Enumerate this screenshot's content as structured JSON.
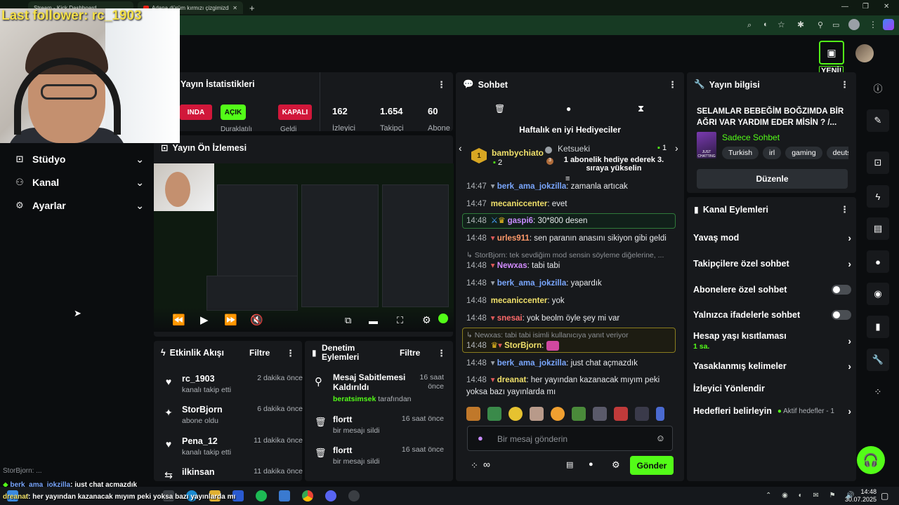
{
  "browser": {
    "tabs": [
      {
        "label": "Stream - Kick Dashboard"
      },
      {
        "label": "Adana dürüm kırmızı çizgimizdir"
      }
    ],
    "new_tab": "+",
    "win_min": "—",
    "win_max": "❐",
    "win_close": "✕"
  },
  "overlay": {
    "follower_text": "Last follower: rc_1903"
  },
  "header": {
    "new_badge": "YENİ!"
  },
  "sidebar": {
    "items": [
      {
        "label": "Stüdyo",
        "icon": "studio-icon"
      },
      {
        "label": "Kanal",
        "icon": "users-icon"
      },
      {
        "label": "Ayarlar",
        "icon": "gear-icon"
      }
    ]
  },
  "stats": {
    "title": "Yayın İstatistikleri",
    "status_left": "INDA",
    "open_label": "AÇIK",
    "closed_label": "KAPALI",
    "sub_left": "Duraklatılı",
    "sub_closed": "Geldi",
    "viewers_value": "162",
    "viewers_label": "İzleyici",
    "followers_value": "1.654",
    "followers_label": "Takipçi",
    "subs_value": "60",
    "subs_label": "Abone"
  },
  "preview": {
    "title": "Yayın Ön İzlemesi"
  },
  "activity": {
    "title": "Etkinlik Akışı",
    "filter": "Filtre",
    "items": [
      {
        "name": "rc_1903",
        "sub": "kanalı takip etti",
        "time": "2 dakika önce",
        "icon": "heart-icon"
      },
      {
        "name": "StorBjorn",
        "sub": "abone oldu",
        "time": "6 dakika önce",
        "icon": "sparkle-icon"
      },
      {
        "name": "Pena_12",
        "sub": "kanalı takip etti",
        "time": "11 dakika önce",
        "icon": "heart-icon"
      },
      {
        "name": "ilkinsan",
        "sub": "",
        "time": "11 dakika önce",
        "icon": "host-icon"
      }
    ]
  },
  "moderation": {
    "title_line1": "Denetim",
    "title_line2": "Eylemleri",
    "filter": "Filtre",
    "items": [
      {
        "title_line1": "Mesaj Sabitlemesi",
        "title_line2": "Kaldırıldı",
        "by_user": "beratsimsek",
        "by_suffix": " tarafından",
        "time_line1": "16 saat",
        "time_line2": "önce"
      },
      {
        "title_line1": "flortt",
        "sub": "bir mesajı sildi",
        "time_line1": "16 saat önce"
      },
      {
        "title_line1": "flortt",
        "sub": "bir mesajı sildi",
        "time_line1": "16 saat önce"
      }
    ]
  },
  "chat": {
    "title": "Sohbet",
    "gifters_title": "Haftalık en iyi Hediyeciler",
    "gifter1_name": "bambychiato",
    "gifter1_count": "2",
    "gifter2_name": "Ketsueki",
    "gifter2_count": "1",
    "gifter2_msg_line1": "1 abonelik hediye ederek 3.",
    "gifter2_msg_line2": "sıraya yükselin",
    "lines": [
      {
        "time": "14:47",
        "user": "berk_ama_jokzilla",
        "color": "#7aa7ff",
        "text": "zamanla artıcak"
      },
      {
        "time": "14:47",
        "user": "mecaniccenter",
        "color": "#f0e06a",
        "text": "evet"
      },
      {
        "time": "14:48",
        "user": "gaspi6",
        "color": "#c88cff",
        "text": "30*800 desen"
      },
      {
        "time": "14:48",
        "user": "urles911",
        "color": "#ff9a6a",
        "text": "sen paranın anasını sikiyon gibi geldi"
      },
      {
        "time": "14:48",
        "user": "Newxas",
        "color": "#d38cff",
        "text": "tabi tabi"
      },
      {
        "time": "14:48",
        "user": "berk_ama_jokzilla",
        "color": "#7aa7ff",
        "text": "yapardık"
      },
      {
        "time": "14:48",
        "user": "mecaniccenter",
        "color": "#f0e06a",
        "text": "yok"
      },
      {
        "time": "14:48",
        "user": "snesai",
        "color": "#ff6a6a",
        "text": "yok beolm öyle şey mi var"
      },
      {
        "time": "14:48",
        "user": "StorBjorn",
        "color": "#f0e06a",
        "text": ""
      },
      {
        "time": "14:48",
        "user": "berk_ama_jokzilla",
        "color": "#7aa7ff",
        "text": "just chat açmazdık"
      },
      {
        "time": "14:48",
        "user": "dreanat",
        "color": "#f0e06a",
        "text": "her yayından kazanacak mıyım peki"
      },
      {
        "time": "",
        "user": "",
        "color": "#fff",
        "text": "yoksa bazı yayınlarda mı"
      }
    ],
    "reply1": "StorBjorn: tek sevdiğim mod sensin söyleme diğelerine, ...",
    "reply2": "Newxas: tabi tabi isimli kullanıcıya yanıt veriyor",
    "input_placeholder": "Bir mesaj gönderin",
    "send_label": "Gönder"
  },
  "stream_info": {
    "title": "Yayın bilgisi",
    "stream_title_line1": "SELAMLAR BEBEĞİM BOĞZIMDA BİR",
    "stream_title_line2": "AĞRI VAR YARDIM EDER MİSİN ? /...",
    "category": "Sadece Sohbet",
    "thumb_text": "JUST CHATTING",
    "tags": [
      "Turkish",
      "irl",
      "gaming",
      "deutsc"
    ],
    "edit_label": "Düzenle"
  },
  "channel_actions": {
    "title": "Kanal Eylemleri",
    "items": [
      {
        "label": "Yavaş mod",
        "type": "chevron"
      },
      {
        "label": "Takipçilere özel sohbet",
        "type": "chevron"
      },
      {
        "label": "Abonelere özel sohbet",
        "type": "toggle"
      },
      {
        "label": "Yalnızca ifadelerle sohbet",
        "type": "toggle"
      },
      {
        "label": "Hesap yaşı kısıtlaması",
        "type": "chevron",
        "sub": "1 sa."
      },
      {
        "label": "Yasaklanmış kelimeler",
        "type": "chevron"
      },
      {
        "label": "İzleyici Yönlendir",
        "type": "none"
      },
      {
        "label": "Hedefleri belirleyin",
        "type": "chevron",
        "extra": "Aktif hedefler - 1"
      }
    ]
  },
  "overlay_chat": {
    "line1": "StorBjorn: ...",
    "line2_user": "berk_ama_jokzilla",
    "line2_text": ": just chat açmazdık",
    "line3_user": "dreanat",
    "line3_text": ": her yayından kazanacak mıyım peki yoksa bazı yayınlarda mı"
  },
  "taskbar": {
    "time": "14:48",
    "date": "30.07.2025"
  },
  "colors": {
    "accent": "#53fc18",
    "danger": "#d1173a",
    "panel": "#17191c",
    "bg": "#0b0d0f"
  }
}
